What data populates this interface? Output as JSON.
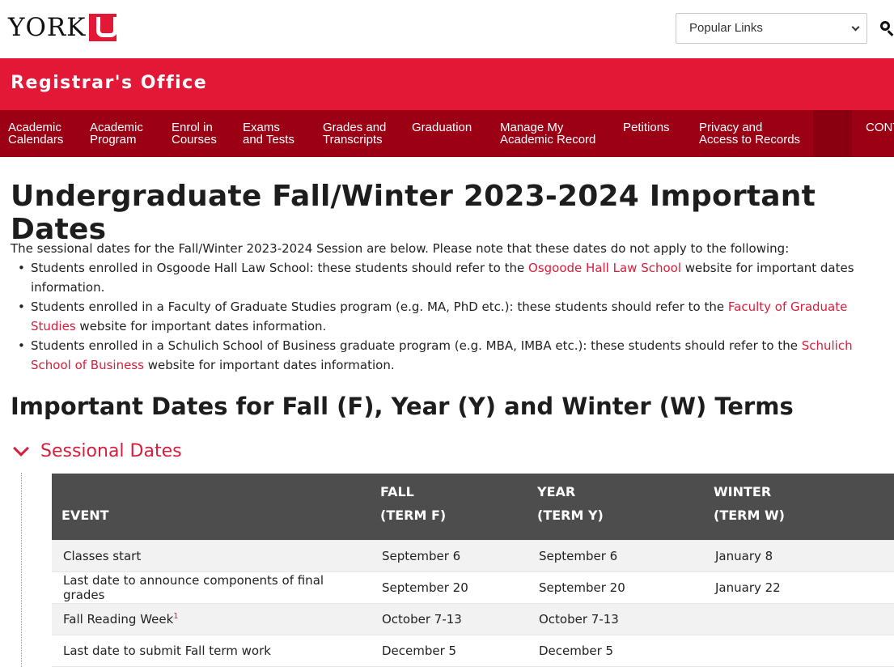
{
  "logo": {
    "text": "YORK"
  },
  "header": {
    "popular_links_label": "Popular Links"
  },
  "banner": {
    "title": "Registrar's Office"
  },
  "nav": [
    "Academic\nCalendars",
    "Academic\nProgram",
    "Enrol in\nCourses",
    "Exams\nand Tests",
    "Grades and\nTranscripts",
    "Graduation",
    "Manage My\nAcademic Record",
    "Petitions",
    "Privacy and\nAccess to Records",
    "CONT"
  ],
  "page": {
    "title": "Undergraduate Fall/Winter 2023-2024 Important Dates",
    "intro": "The sessional dates for the Fall/Winter 2023-2024 Session are below. Please note that these dates do not apply to the following:",
    "bullets": [
      {
        "before": "Students enrolled in Osgoode Hall Law School: these students should refer to the ",
        "link": "Osgoode Hall Law School",
        "after": " website for important dates information."
      },
      {
        "before": "Students enrolled in a Faculty of Graduate Studies program (e.g. MA, PhD etc.): these students should refer to the ",
        "link": "Faculty of Graduate Studies",
        "after": " website for important dates information."
      },
      {
        "before": "Students enrolled in a Schulich School of Business graduate program (e.g. MBA, IMBA etc.): these students should refer to the ",
        "link": "Schulich School of Business",
        "after": " website for important dates information."
      }
    ],
    "section_heading": "Important Dates for Fall (F), Year (Y) and Winter (W) Terms",
    "accordion_label": "Sessional Dates"
  },
  "table": {
    "headers": [
      {
        "line1": "",
        "line2": "EVENT"
      },
      {
        "line1": "FALL",
        "line2": "(TERM F)"
      },
      {
        "line1": "YEAR",
        "line2": "(TERM Y)"
      },
      {
        "line1": "WINTER",
        "line2": "(TERM W)"
      }
    ],
    "rows": [
      {
        "event": "Classes start",
        "sup": "",
        "fall": "September 6",
        "year": "September 6",
        "winter": "January 8"
      },
      {
        "event": "Last date to announce components of final grades",
        "sup": "",
        "fall": "September 20",
        "year": "September 20",
        "winter": "January 22"
      },
      {
        "event": "Fall Reading Week",
        "sup": "1",
        "fall": "October 7-13",
        "year": "October 7-13",
        "winter": ""
      },
      {
        "event": "Last date to submit Fall term work",
        "sup": "",
        "fall": "December 5",
        "year": "December 5",
        "winter": ""
      }
    ]
  }
}
